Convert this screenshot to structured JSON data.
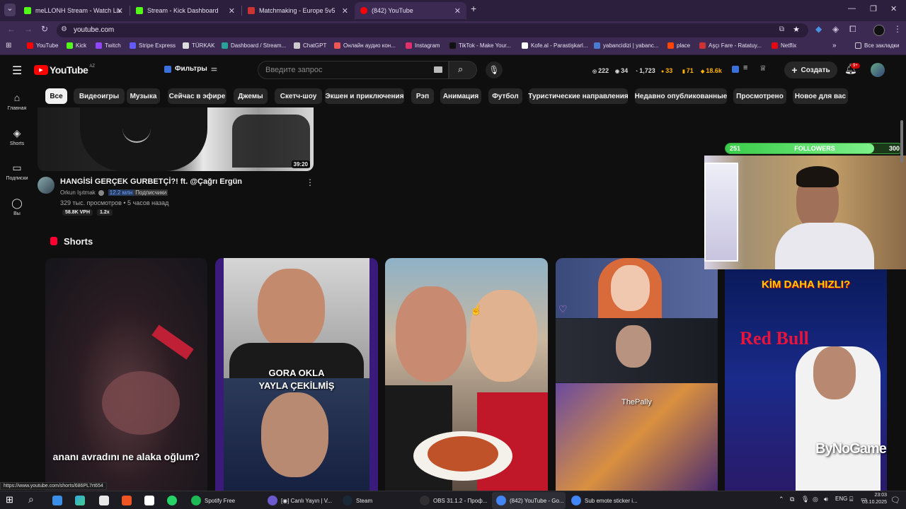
{
  "browser": {
    "tabs": [
      {
        "title": "meLLONH Stream - Watch Live",
        "color": "#53fc18"
      },
      {
        "title": "Stream - Kick Dashboard",
        "color": "#53fc18"
      },
      {
        "title": "Matchmaking - Europe 5v5 Qu",
        "color": "#cc3333"
      },
      {
        "title": "(842) YouTube",
        "color": "#ff0000"
      }
    ],
    "url": "youtube.com",
    "all_bookmarks": "Все закладки",
    "bookmarks": [
      {
        "label": "YouTube",
        "color": "#ff0000"
      },
      {
        "label": "Kick",
        "color": "#53fc18"
      },
      {
        "label": "Twitch",
        "color": "#9146ff"
      },
      {
        "label": "Stripe Express",
        "color": "#635bff"
      },
      {
        "label": "TÜRKAK",
        "color": "#dddddd"
      },
      {
        "label": "Dashboard / Stream...",
        "color": "#2aa198"
      },
      {
        "label": "ChatGPT",
        "color": "#cccccc"
      },
      {
        "label": "Онлайн аудио кон...",
        "color": "#e55"
      },
      {
        "label": "Instagram",
        "color": "#e1306c"
      },
      {
        "label": "TikTok - Make Your...",
        "color": "#111111"
      },
      {
        "label": "Kofe.al - Parastişkarl...",
        "color": "#ffffff"
      },
      {
        "label": "yabancidizi | yabanc...",
        "color": "#4a7bd0"
      },
      {
        "label": "place",
        "color": "#ff4500"
      },
      {
        "label": "Aşçı Fare - Ratatuy...",
        "color": "#c33"
      },
      {
        "label": "Netflix",
        "color": "#e50914"
      }
    ]
  },
  "youtube": {
    "logo": "YouTube",
    "region": "AZ",
    "filters_label": "Фильтры",
    "search_placeholder": "Введите запрос",
    "stats": [
      "222",
      "34",
      "1,723",
      "33",
      "71",
      "18.6k"
    ],
    "create_label": "Создать",
    "notif_count": "9+",
    "sidebar": [
      {
        "label": "Главная",
        "icon": "home-icon"
      },
      {
        "label": "Shorts",
        "icon": "shorts-icon"
      },
      {
        "label": "Подписки",
        "icon": "subscriptions-icon"
      },
      {
        "label": "Вы",
        "icon": "you-icon"
      }
    ],
    "chips": [
      "Все",
      "Видеоигры",
      "Музыка",
      "Сейчас в эфире",
      "Джемы",
      "Скетч-шоу",
      "Экшен и приключения",
      "Рэп",
      "Анимация",
      "Футбол",
      "Туристические направления",
      "Недавно опубликованные",
      "Просмотрено",
      "Новое для вас"
    ],
    "video": {
      "duration": "39:20",
      "title": "HANGİSİ GERÇEK GURBETÇİ?! ft. @Çağrı Ergün",
      "channel": "Orkun Işıtmak",
      "subs": "12.2 млн",
      "subs_label": "Подписчики",
      "meta": "329 тыс. просмотров • 5 часов назад",
      "vph": "58.8K VPH",
      "ratio": "1.2x"
    },
    "shorts_title": "Shorts",
    "shorts": [
      {
        "caption": "ananı avradını ne alaka oğlum?"
      },
      {
        "caption1": "GORA OKLA",
        "caption2": "YAYLA ÇEKİLMİŞ"
      },
      {
        "caption": ""
      },
      {
        "caption": "ThePally"
      },
      {
        "caption1": "KİM DAHA HIZLI?",
        "caption2": "Red Bull"
      }
    ],
    "status_url": "https://www.youtube.com/shorts/686PL7rt654"
  },
  "overlay": {
    "followers_current": "251",
    "followers_label": "FOLLOWERS",
    "followers_goal": "300",
    "followers_fraction": 0.84,
    "watermark": "ByNoGame"
  },
  "taskbar": {
    "items": [
      "Spotify Free",
      "[◉] Canlı Yayın | V...",
      "Steam",
      "OBS 31.1.2 - Проф...",
      "(842) YouTube - Go...",
      "Sub emote sticker i..."
    ],
    "lang": "ENG",
    "time": "23:03",
    "date": "03.10.2025"
  }
}
